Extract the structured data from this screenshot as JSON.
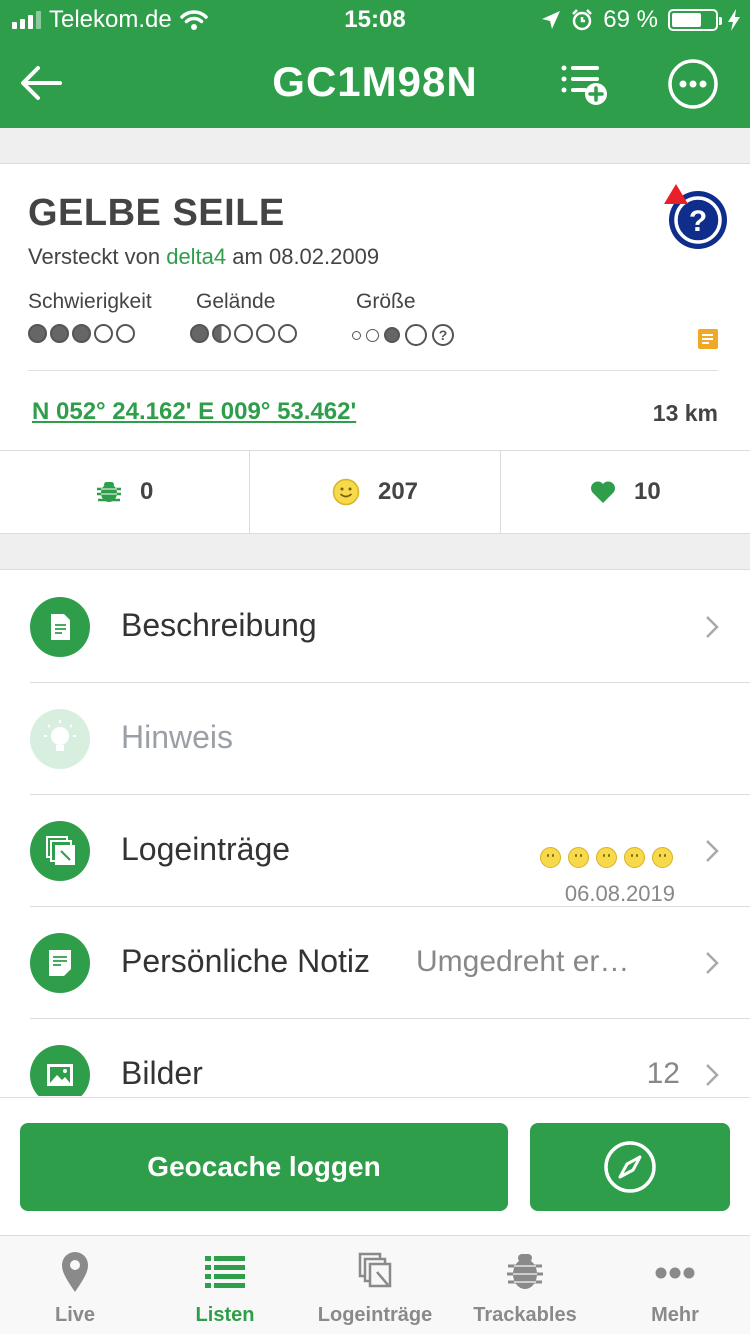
{
  "status_bar": {
    "carrier": "Telekom.de",
    "time": "15:08",
    "battery": "69 %"
  },
  "header": {
    "title": "GC1M98N",
    "accent_color": "#2f9e4a"
  },
  "cache": {
    "name": "GELBE SEILE",
    "hidden_prefix": "Versteckt von",
    "owner": "delta4",
    "date_prefix": "am",
    "hidden_date": "08.02.2009",
    "difficulty_label": "Schwierigkeit",
    "difficulty": 3,
    "terrain_label": "Gelände",
    "terrain": 1.5,
    "size_label": "Größe",
    "coordinates": "N 052° 24.162' E 009° 53.462'",
    "distance": "13 km"
  },
  "stats": {
    "trackables": "0",
    "finds": "207",
    "favorites": "10"
  },
  "menu": {
    "description": "Beschreibung",
    "hint": "Hinweis",
    "logs": "Logeinträge",
    "logs_date": "06.08.2019",
    "personal_note": "Persönliche Notiz",
    "personal_note_preview": "Umgedreht er…",
    "images": "Bilder",
    "images_count": "12"
  },
  "actions": {
    "log_button": "Geocache loggen"
  },
  "tabs": [
    {
      "label": "Live",
      "icon": "pin-icon"
    },
    {
      "label": "Listen",
      "icon": "list-icon"
    },
    {
      "label": "Logeinträge",
      "icon": "logs-icon"
    },
    {
      "label": "Trackables",
      "icon": "bug-icon"
    },
    {
      "label": "Mehr",
      "icon": "more-icon"
    }
  ]
}
